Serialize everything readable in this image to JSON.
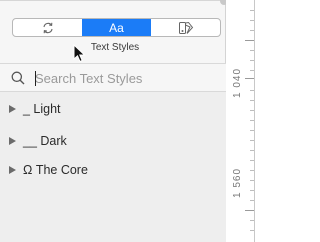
{
  "segmented_control": {
    "segments": [
      {
        "name": "sync",
        "icon": "sync-icon",
        "label": ""
      },
      {
        "name": "text-styles",
        "icon": "",
        "label": "Aa"
      },
      {
        "name": "swatches",
        "icon": "color-swatch-icon",
        "label": ""
      }
    ],
    "active_index": 1,
    "active_caption": "Text Styles"
  },
  "search": {
    "icon": "search-icon",
    "placeholder": "Search Text Styles",
    "value": ""
  },
  "groups": [
    {
      "label": "_ Light",
      "expanded": false
    },
    {
      "label": "__ Dark",
      "expanded": false
    },
    {
      "label": "Ω The Core",
      "expanded": false
    }
  ],
  "ruler": {
    "labels": [
      "1 040",
      "1 560"
    ]
  },
  "colors": {
    "accent": "#1b7cf7",
    "panel_bg": "#f6f6f6",
    "list_bg": "#eeeeee"
  }
}
